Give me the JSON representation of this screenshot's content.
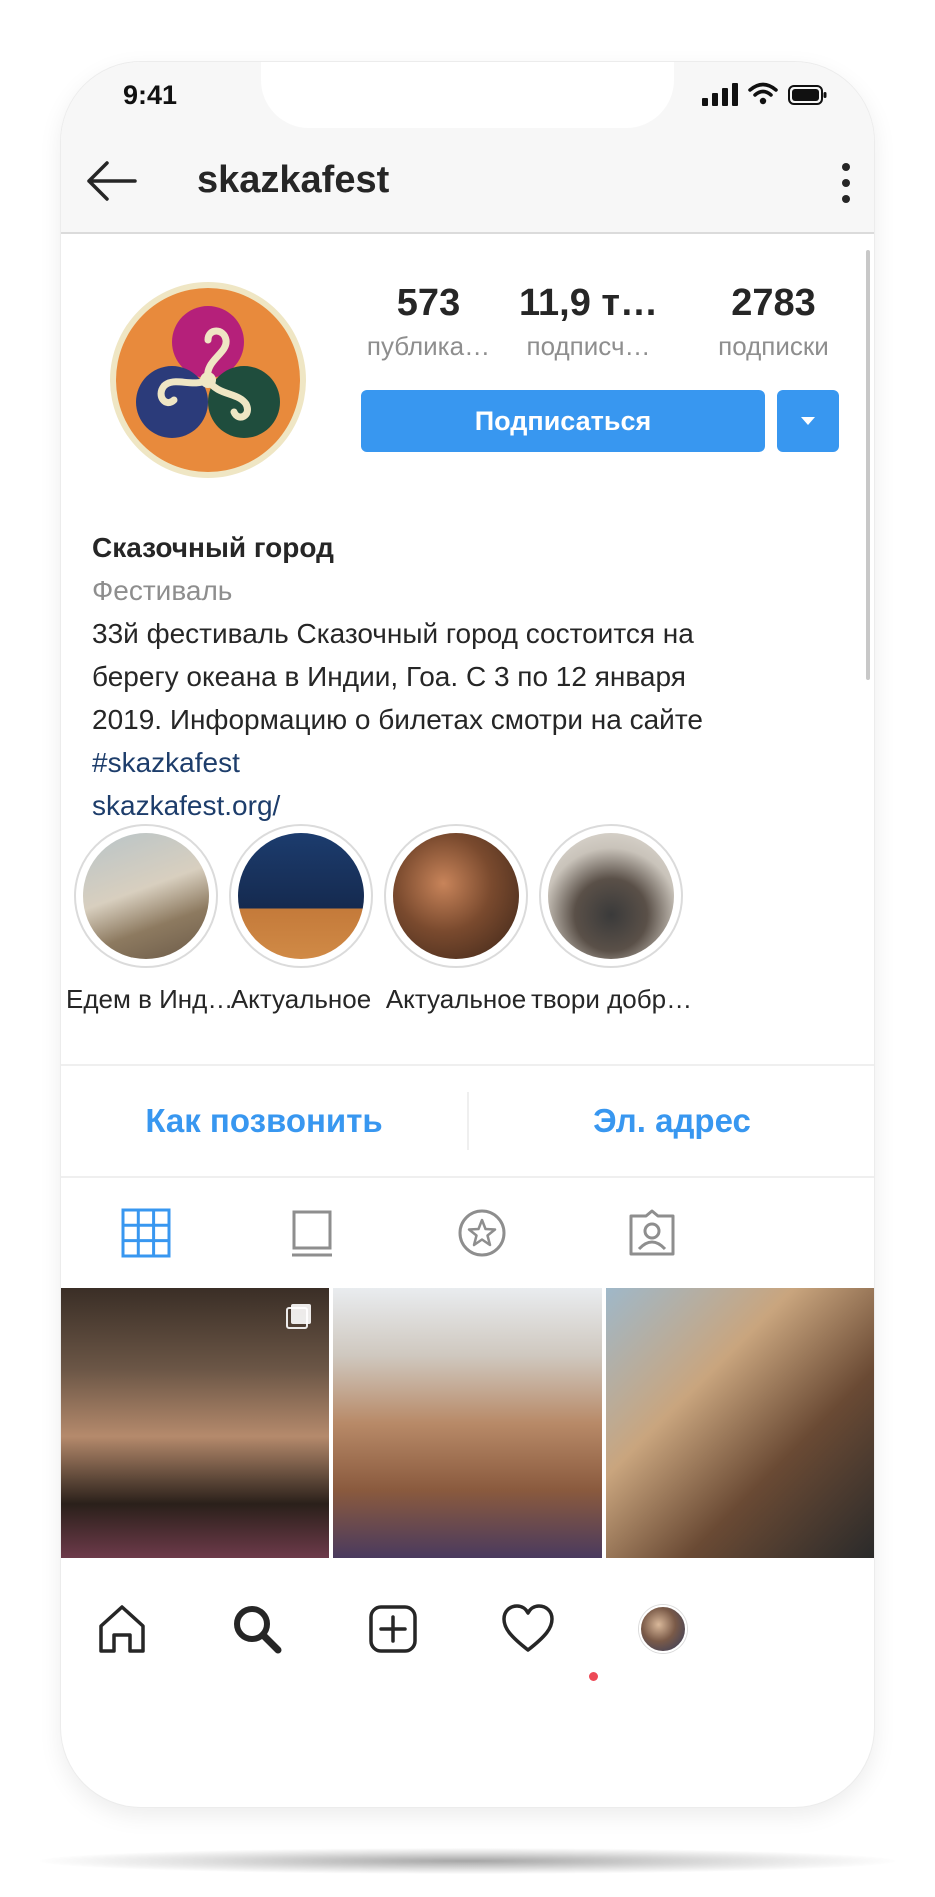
{
  "status_bar": {
    "time": "9:41"
  },
  "header": {
    "username": "skazkafest"
  },
  "profile": {
    "stats": [
      {
        "value": "573",
        "label": "публика…"
      },
      {
        "value": "11,9 т…",
        "label": "подписч…"
      },
      {
        "value": "2783",
        "label": "подписки"
      }
    ],
    "follow_label": "Подписаться",
    "name": "Сказочный город",
    "category": "Фестиваль",
    "bio_lines": [
      "33й фестиваль Сказочный город состоится на",
      "берегу океана в Индии, Гоа. С 3 по 12 января",
      "2019. Информацию о билетах смотри на сайте"
    ],
    "hashtag": "#skazkafest",
    "website": "skazkafest.org/"
  },
  "highlights": [
    {
      "label": "Едем в Инд…"
    },
    {
      "label": "Актуальное"
    },
    {
      "label": "Актуальное"
    },
    {
      "label": "твори добр…"
    }
  ],
  "contact": {
    "call_label": "Как позвонить",
    "email_label": "Эл. адрес"
  },
  "tabs": [
    {
      "icon": "grid-icon",
      "active": true
    },
    {
      "icon": "feed-icon",
      "active": false
    },
    {
      "icon": "star-icon",
      "active": false
    },
    {
      "icon": "tagged-icon",
      "active": false
    }
  ],
  "bottom_nav": [
    "home-icon",
    "search-icon",
    "add-icon",
    "heart-icon",
    "profile-avatar"
  ],
  "colors": {
    "accent": "#3897f0",
    "link": "#1d3d6b",
    "muted": "#8e8e8e",
    "logo_orange": "#e88a3c",
    "logo_magenta": "#b5207a",
    "logo_navy": "#2b3b7a",
    "logo_green": "#1f4d3d",
    "notification_dot": "#ed4956"
  }
}
